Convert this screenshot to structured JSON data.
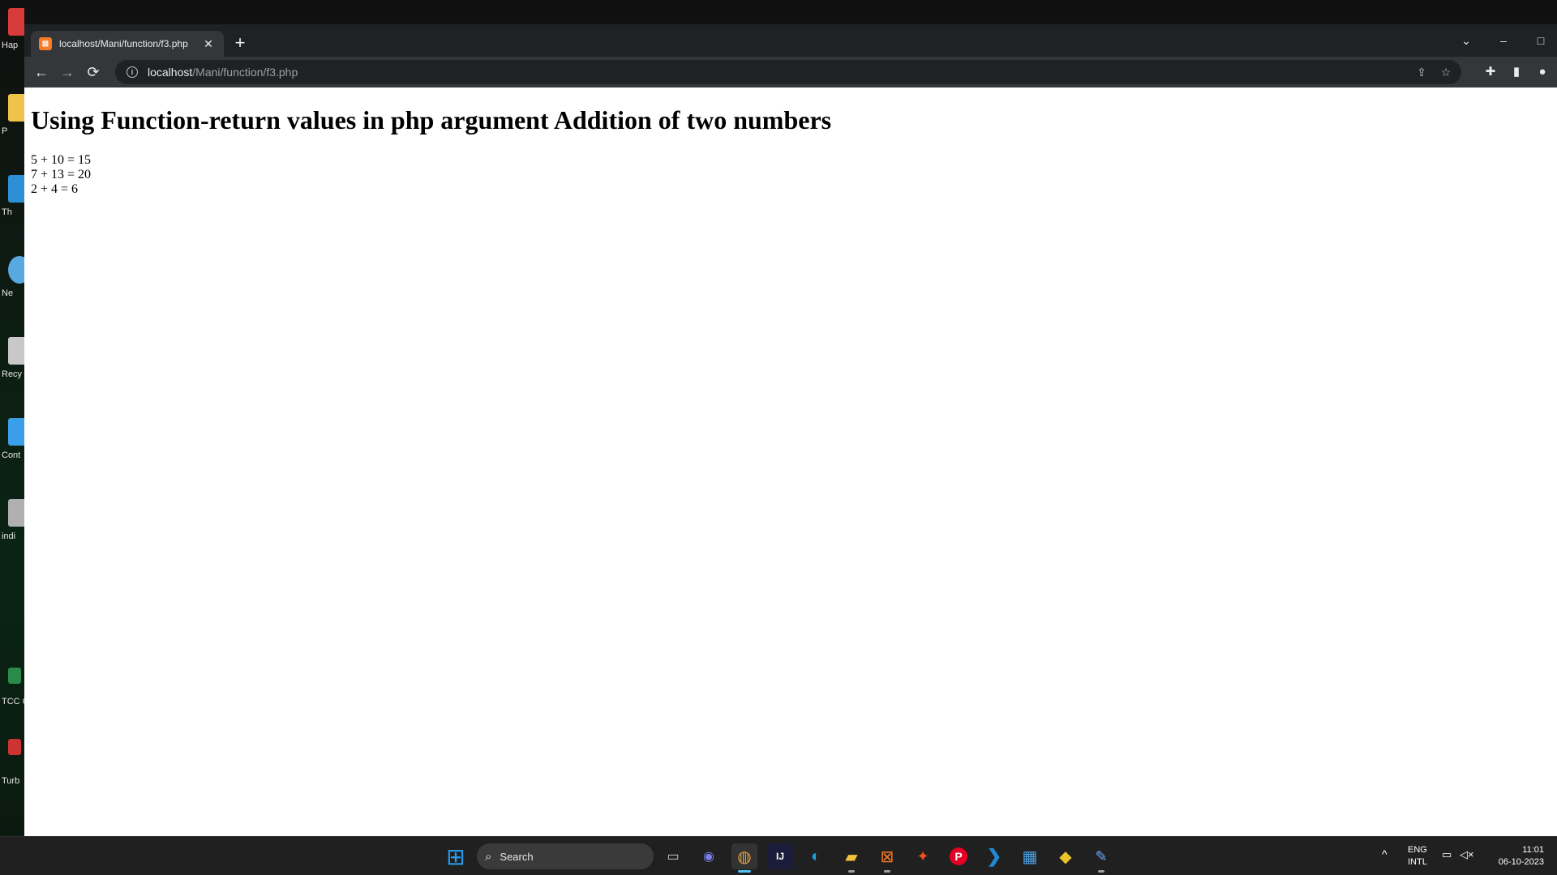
{
  "desktop": {
    "icons": [
      {
        "label": "Hap",
        "color": "#d63a3a"
      },
      {
        "label": "P",
        "color": "#f0c24a"
      },
      {
        "label": "Th",
        "color": "#2e8fd6"
      },
      {
        "label": "Ne",
        "color": "#5aa8e0"
      },
      {
        "label": "Recy",
        "color": "#c8c8c8"
      },
      {
        "label": "Cont",
        "color": "#3b9ee8"
      },
      {
        "label": "indi",
        "color": "#b0b0b0"
      },
      {
        "label": "TCC Ce",
        "color": "#2a8a4a"
      },
      {
        "label": "Turb",
        "color": "#c33"
      }
    ]
  },
  "browser": {
    "tab": {
      "title": "localhost/Mani/function/f3.php",
      "favicon": "xampp-icon"
    },
    "newtab_icon": "+",
    "window_controls": {
      "dropdown": "⌄",
      "minimize": "–",
      "maximize": "□"
    },
    "nav": {
      "back": "←",
      "forward": "→",
      "reload": "⟳"
    },
    "address": {
      "host": "localhost",
      "path": "/Mani/function/f3.php",
      "info": "i"
    },
    "omnibox_icons": {
      "share": "⇪",
      "bookmark": "☆"
    },
    "toolbar_icons": {
      "extensions": "✚",
      "side_panel": "▮",
      "profile": "●"
    }
  },
  "page": {
    "heading": "Using Function-return values in php argument Addition of two numbers",
    "lines": [
      "5 + 10 = 15",
      "7 + 13 = 20",
      "2 + 4 = 6"
    ]
  },
  "taskbar": {
    "search_label": "Search",
    "apps": [
      {
        "name": "start",
        "glyph": "⊞",
        "color": "#2b9cf0"
      },
      {
        "name": "task-view",
        "glyph": "▭",
        "color": "#d0d0d0"
      },
      {
        "name": "teams",
        "glyph": "◉",
        "color": "#6264a7"
      },
      {
        "name": "chrome",
        "glyph": "◍",
        "color": "#e9a23b"
      },
      {
        "name": "intellij",
        "glyph": "IJ",
        "color": "#1b1b3a"
      },
      {
        "name": "edge",
        "glyph": "◐",
        "color": "#1aa0d8"
      },
      {
        "name": "file-explorer",
        "glyph": "▰",
        "color": "#f5c33b"
      },
      {
        "name": "xampp",
        "glyph": "⊠",
        "color": "#fb7a24"
      },
      {
        "name": "figma",
        "glyph": "✦",
        "color": "#f24e1e"
      },
      {
        "name": "pinterest",
        "glyph": "P",
        "color": "#e60023"
      },
      {
        "name": "vscode",
        "glyph": "❯",
        "color": "#1f8ad2"
      },
      {
        "name": "store",
        "glyph": "▦",
        "color": "#0f6cbd"
      },
      {
        "name": "git",
        "glyph": "◆",
        "color": "#e8c32a"
      },
      {
        "name": "notepad",
        "glyph": "✎",
        "color": "#3a7bd5"
      }
    ],
    "tray": {
      "chevron": "^",
      "lang_top": "ENG",
      "lang_bottom": "INTL",
      "time": "11:01",
      "date": "06-10-2023"
    }
  }
}
